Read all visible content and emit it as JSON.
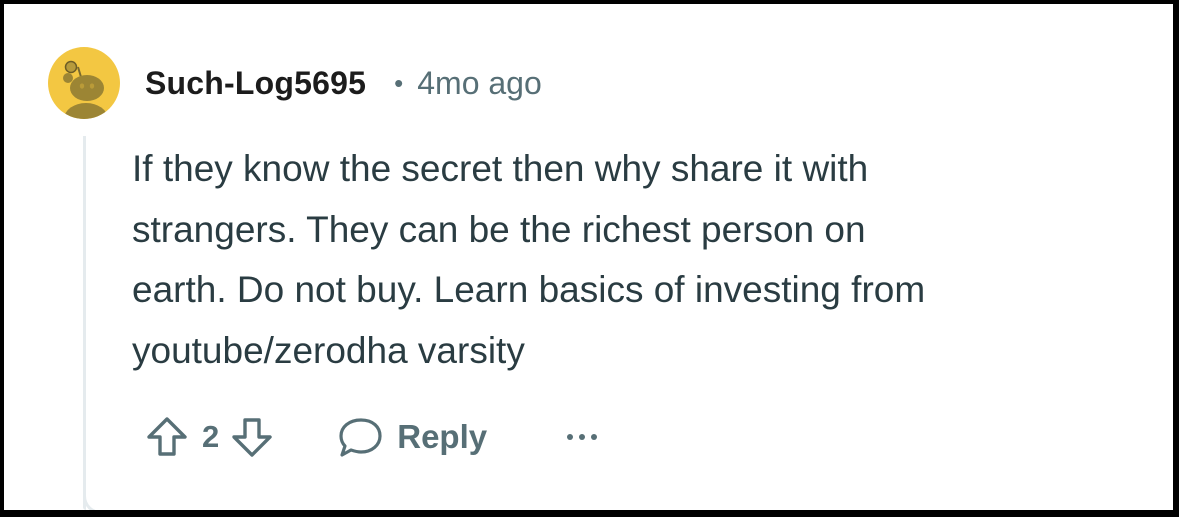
{
  "comment": {
    "author": "Such-Log5695",
    "separator": "•",
    "timestamp": "4mo ago",
    "body_lines": [
      "If they know the secret then why share it with",
      "strangers. They can be the richest person on",
      "earth. Do not buy. Learn basics of investing from",
      "youtube/zerodha varsity"
    ],
    "vote_count": "2",
    "reply_label": "Reply",
    "icons": {
      "avatar": "snoo-avatar-icon",
      "upvote": "upvote-arrow-icon",
      "downvote": "downvote-arrow-icon",
      "reply": "speech-bubble-icon",
      "more": "more-options-icon"
    }
  },
  "colors": {
    "avatar_bg": "#f3c742",
    "username": "#1c1c1c",
    "meta": "#576f76",
    "body": "#2a3c42",
    "thread_line": "#e5ebee"
  }
}
